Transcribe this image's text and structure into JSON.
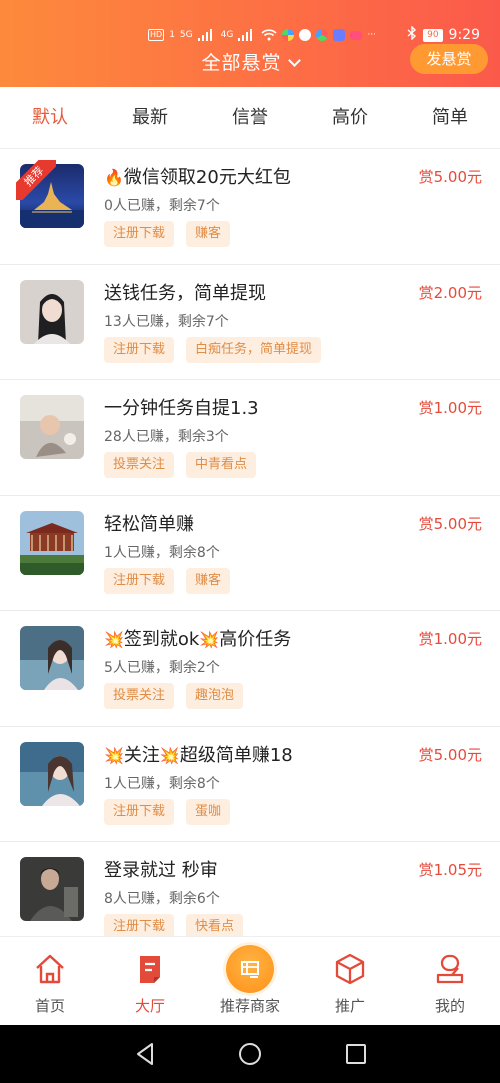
{
  "statusbar": {
    "hd_label": "HD",
    "hd_sub": "1",
    "net1": "5G",
    "net2": "4G",
    "more": "···",
    "battery": "90",
    "time": "9:29"
  },
  "header": {
    "title": "全部悬赏",
    "post_button": "发悬赏"
  },
  "tabs": [
    {
      "label": "默认",
      "active": true
    },
    {
      "label": "最新",
      "active": false
    },
    {
      "label": "信誉",
      "active": false
    },
    {
      "label": "高价",
      "active": false
    },
    {
      "label": "简单",
      "active": false
    }
  ],
  "tasks": [
    {
      "badge": "推荐",
      "emoji": "🔥",
      "title": "微信领取20元大红包",
      "price": "赏5.00元",
      "meta": "0人已赚，剩余7个",
      "tags": [
        "注册下载",
        "赚客"
      ],
      "thumb": "castle"
    },
    {
      "title": "送钱任务，简单提现",
      "price": "赏2.00元",
      "meta": "13人已赚，剩余7个",
      "tags": [
        "注册下载",
        "白痴任务，简单提现"
      ],
      "thumb": "anime"
    },
    {
      "title": "一分钟任务自提1.3",
      "price": "赏1.00元",
      "meta": "28人已赚，剩余3个",
      "tags": [
        "投票关注",
        "中青看点"
      ],
      "thumb": "baby"
    },
    {
      "title": "轻松简单赚",
      "price": "赏5.00元",
      "meta": "1人已赚，剩余8个",
      "tags": [
        "注册下载",
        "赚客"
      ],
      "thumb": "pavilion"
    },
    {
      "emoji": "💥",
      "title": "签到就ok",
      "emoji2": "💥",
      "title2": "高价任务",
      "price": "赏1.00元",
      "meta": "5人已赚，剩余2个",
      "tags": [
        "投票关注",
        "趣泡泡"
      ],
      "thumb": "girl"
    },
    {
      "emoji": "💥",
      "title": "关注",
      "emoji2": "💥",
      "title2": "超级简单赚18",
      "price": "赏5.00元",
      "meta": "1人已赚，剩余8个",
      "tags": [
        "注册下载",
        "蛋咖"
      ],
      "thumb": "girl2"
    },
    {
      "title": "登录就过  秒审",
      "price": "赏1.05元",
      "meta": "8人已赚，剩余6个",
      "tags": [
        "注册下载",
        "快看点"
      ],
      "thumb": "man"
    }
  ],
  "bottom_nav": [
    {
      "label": "首页",
      "icon": "home-icon",
      "active": false
    },
    {
      "label": "大厅",
      "icon": "hall-icon",
      "active": true
    },
    {
      "label": "推荐商家",
      "icon": "merchant-icon",
      "active": false
    },
    {
      "label": "推广",
      "icon": "cube-icon",
      "active": false
    },
    {
      "label": "我的",
      "icon": "profile-icon",
      "active": false
    }
  ],
  "colors": {
    "header_start": "#fd8a3c",
    "header_end": "#fb5a4b",
    "accent_red": "#e54a3a",
    "tag_bg": "#fdeee0",
    "tag_text": "#e08d46"
  }
}
